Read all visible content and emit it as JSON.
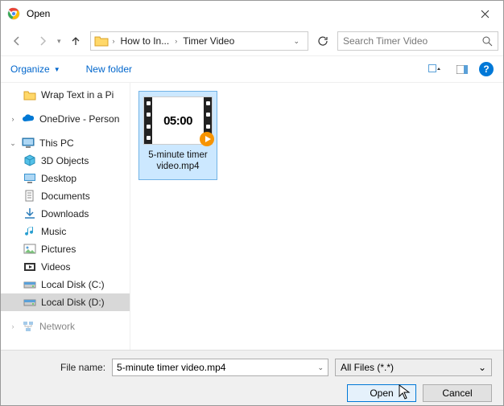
{
  "title": "Open",
  "nav": {
    "crumb1": "How to In...",
    "crumb2": "Timer Video"
  },
  "search": {
    "placeholder": "Search Timer Video"
  },
  "toolbar": {
    "organize": "Organize",
    "newfolder": "New folder"
  },
  "sidebar": {
    "wrap": "Wrap Text in a Pi",
    "onedrive": "OneDrive - Person",
    "thispc": "This PC",
    "objects3d": "3D Objects",
    "desktop": "Desktop",
    "documents": "Documents",
    "downloads": "Downloads",
    "music": "Music",
    "pictures": "Pictures",
    "videos": "Videos",
    "diskc": "Local Disk (C:)",
    "diskd": "Local Disk (D:)",
    "network": "Network"
  },
  "file": {
    "thumb_text": "05:00",
    "name": "5-minute timer video.mp4"
  },
  "footer": {
    "filename_label": "File name:",
    "filename_value": "5-minute timer video.mp4",
    "filter": "All Files (*.*)",
    "open": "Open",
    "cancel": "Cancel"
  }
}
